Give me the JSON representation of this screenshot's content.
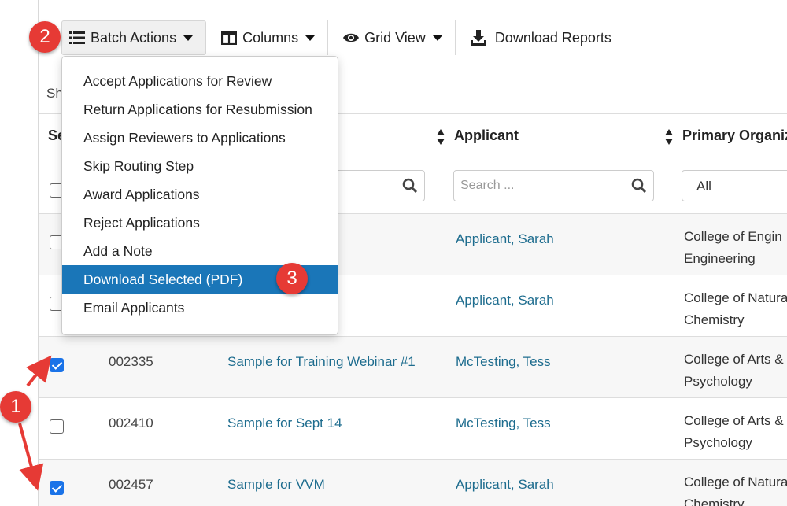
{
  "toolbar": {
    "batch_actions": "Batch Actions",
    "columns": "Columns",
    "grid_view": "Grid View",
    "download_reports": "Download Reports"
  },
  "show_text": "Sh",
  "table": {
    "headers": {
      "select": "Se",
      "applicant": "Applicant",
      "primary_org": "Primary Organiz"
    },
    "filters": {
      "applicant_placeholder": "Search ...",
      "org_select": "All"
    },
    "rows": [
      {
        "id": "",
        "title": "",
        "applicant": "Applicant, Sarah",
        "org_line1": "College of Engin",
        "org_line2": "Engineering",
        "checked": false
      },
      {
        "id": "",
        "title": "",
        "applicant": "Applicant, Sarah",
        "org_line1": "College of Natura",
        "org_line2": "Chemistry",
        "checked": false
      },
      {
        "id": "002335",
        "title": "Sample for Training Webinar #1",
        "applicant": "McTesting, Tess",
        "org_line1": "College of Arts &",
        "org_line2": "Psychology",
        "checked": true
      },
      {
        "id": "002410",
        "title": "Sample for Sept 14",
        "applicant": "McTesting, Tess",
        "org_line1": "College of Arts &",
        "org_line2": "Psychology",
        "checked": false
      },
      {
        "id": "002457",
        "title": "Sample for VVM",
        "applicant": "Applicant, Sarah",
        "org_line1": "College of Natura",
        "org_line2": "Chemistry",
        "checked": true
      }
    ]
  },
  "menu": {
    "items": [
      "Accept Applications for Review",
      "Return Applications for Resubmission",
      "Assign Reviewers to Applications",
      "Skip Routing Step",
      "Award Applications",
      "Reject Applications",
      "Add a Note",
      "Download Selected (PDF)",
      "Email Applicants"
    ],
    "highlighted_index": 7
  },
  "callouts": [
    "1",
    "2",
    "3"
  ],
  "colors": {
    "link": "#1d6c8e",
    "highlight": "#1a76b8",
    "callout": "#e63a35",
    "checkbox": "#1a73e8"
  }
}
